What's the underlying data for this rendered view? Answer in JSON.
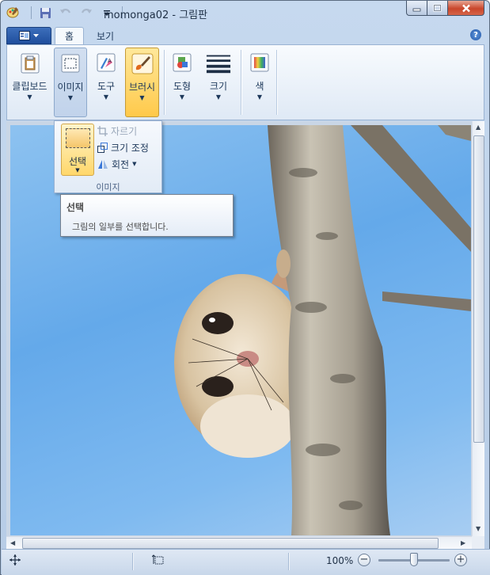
{
  "window": {
    "title": "momonga02 - 그림판",
    "caption_buttons": [
      "minimize",
      "maximize",
      "close"
    ]
  },
  "quick_access": {
    "icons": [
      "save-icon",
      "undo-icon",
      "redo-icon",
      "customize-dropdown-icon"
    ]
  },
  "tabs": [
    {
      "label": "홈",
      "active": true
    },
    {
      "label": "보기",
      "active": false
    }
  ],
  "ribbon": {
    "groups": [
      {
        "id": "clipboard",
        "label": "클립보드",
        "icon": "clipboard-icon",
        "state": "normal"
      },
      {
        "id": "image",
        "label": "이미지",
        "icon": "selection-icon",
        "state": "pressed"
      },
      {
        "id": "tools",
        "label": "도구",
        "icon": "tools-icon",
        "state": "normal"
      },
      {
        "id": "brushes",
        "label": "브러시",
        "icon": "brush-icon",
        "state": "hot"
      },
      {
        "id": "shapes",
        "label": "도형",
        "icon": "shapes-icon",
        "state": "normal"
      },
      {
        "id": "size",
        "label": "크기",
        "icon": "line-size-icon",
        "state": "normal"
      },
      {
        "id": "colors",
        "label": "색",
        "icon": "color-palette-icon",
        "state": "normal"
      }
    ]
  },
  "image_menu": {
    "select_label": "선택",
    "crop_label": "자르기",
    "resize_label": "크기 조정",
    "rotate_label": "회전",
    "group_caption": "이미지"
  },
  "tooltip": {
    "title": "선택",
    "body": "그림의 일부를 선택합니다."
  },
  "status": {
    "zoom": "100%",
    "zoom_level": 0.5
  },
  "colors": {
    "accent_hot": "#ffc94a",
    "sky": "#64a9ea",
    "app_button": "#1f4e9d"
  }
}
